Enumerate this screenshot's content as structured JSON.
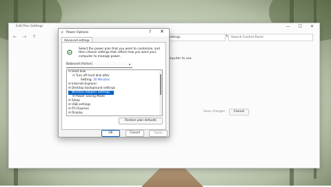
{
  "control_panel": {
    "title": "Edit Plan Settings",
    "window_buttons": [
      "—",
      "☐",
      "✕"
    ],
    "address": "ettings",
    "search_placeholder": "Search Control Panel",
    "partial_text": "omputer to use.",
    "save_label": "Save changes",
    "cancel_label": "Cancel"
  },
  "dialog": {
    "title": "Power Options",
    "help": "?",
    "close": "✕",
    "tab": "Advanced settings",
    "description": "Select the power plan that you want to customize, and then choose settings that reflect how you want your computer to manage power.",
    "plan_selected": "Balanced [Active]",
    "tree": [
      {
        "toggle": "⊟",
        "label": "Hard disk"
      },
      {
        "toggle": "⊟",
        "label": "Turn off hard disk after"
      },
      {
        "toggle": "",
        "label": "Setting: ",
        "value": "20 Minutes"
      },
      {
        "toggle": "⊞",
        "label": "Internet Explorer"
      },
      {
        "toggle": "⊞",
        "label": "Desktop background settings"
      },
      {
        "toggle": "⊟",
        "label": "Wireless Adapter Settings"
      },
      {
        "toggle": "⊞",
        "label": "Power Saving Mode"
      },
      {
        "toggle": "⊞",
        "label": "Sleep"
      },
      {
        "toggle": "⊞",
        "label": "USB settings"
      },
      {
        "toggle": "⊞",
        "label": "PCI Express"
      },
      {
        "toggle": "⊞",
        "label": "Display"
      }
    ],
    "restore_label": "Restore plan defaults",
    "ok_label": "OK",
    "cancel_label": "Cancel",
    "apply_label": "Apply"
  },
  "icons": {
    "back": "←",
    "forward": "→",
    "up": "↑",
    "refresh": "↻",
    "dropdown": "▾"
  }
}
